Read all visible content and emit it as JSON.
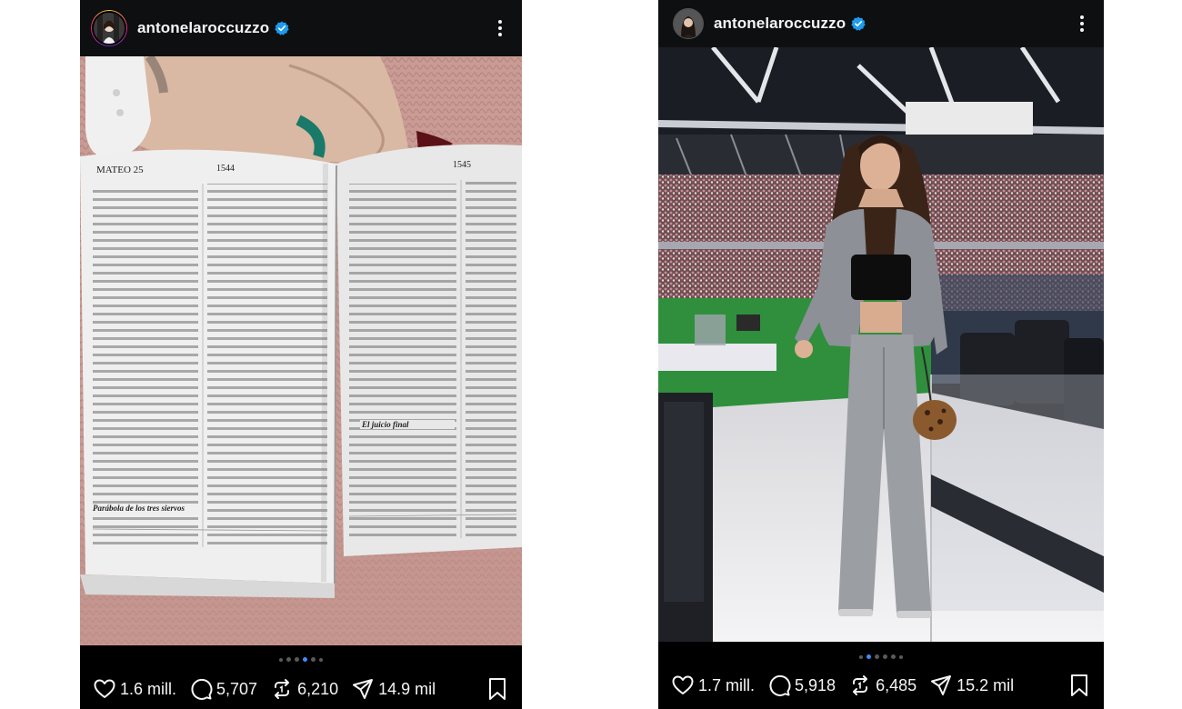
{
  "posts": [
    {
      "username": "antonelaroccuzzo",
      "likes": "1.6 mill.",
      "comments": "5,707",
      "reposts": "6,210",
      "shares": "14.9 mil",
      "carousel": {
        "count": 6,
        "active_index": 3
      },
      "photo": {
        "left_page_header": "MATEO 25",
        "left_page_number": "1544",
        "right_page_number": "1545",
        "heading_left": "Parábola de los tres siervos",
        "heading_right": "El juicio final"
      }
    },
    {
      "username": "antonelaroccuzzo",
      "likes": "1.7 mill.",
      "comments": "5,918",
      "reposts": "6,485",
      "shares": "15.2 mil",
      "carousel": {
        "count": 6,
        "active_index": 1
      }
    }
  ],
  "icons": {
    "verified": "verified-badge-icon",
    "more": "more-vertical-icon",
    "like": "heart-icon",
    "comment": "comment-icon",
    "repost": "repost-icon",
    "share": "send-icon",
    "save": "bookmark-icon"
  },
  "colors": {
    "accent": "#3f8cff",
    "verified": "#1d9bf0",
    "background": "#000000"
  }
}
